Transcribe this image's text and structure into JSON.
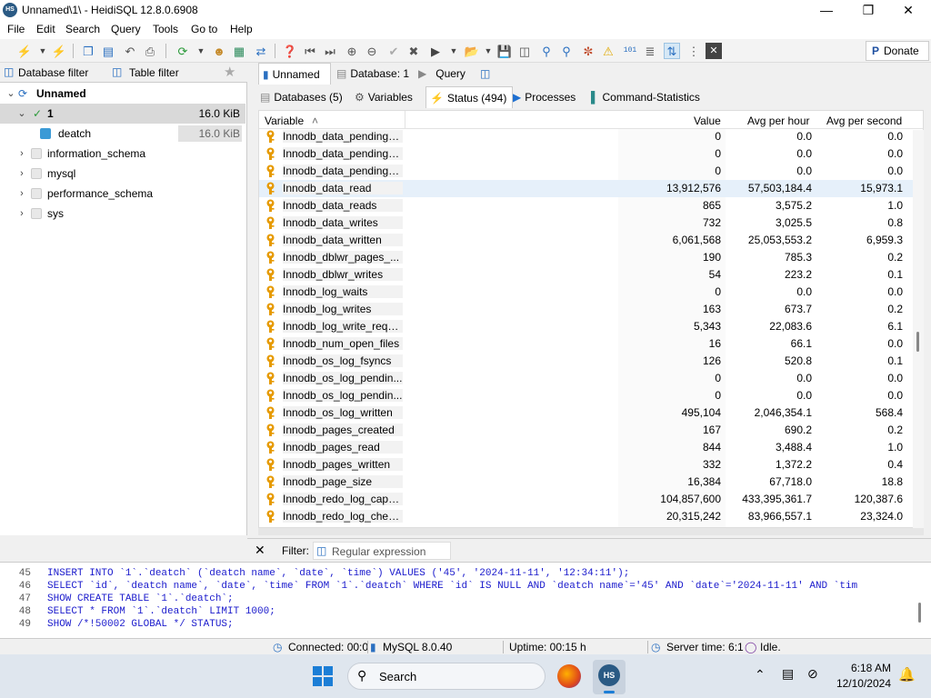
{
  "window": {
    "title": "Unnamed\\1\\ - HeidiSQL 12.8.0.6908",
    "app_badge": "HS"
  },
  "menu": [
    "File",
    "Edit",
    "Search",
    "Query",
    "Tools",
    "Go to",
    "Help"
  ],
  "toolbar": {
    "donate_label": "Donate"
  },
  "left_panel": {
    "db_filter": "Database filter",
    "table_filter": "Table filter",
    "tree": [
      {
        "label": "Unnamed",
        "size": "",
        "level": 0
      },
      {
        "label": "1",
        "size": "16.0 KiB",
        "level": 1
      },
      {
        "label": "deatch",
        "size": "16.0 KiB",
        "level": 2
      },
      {
        "label": "information_schema",
        "size": "",
        "level": 1
      },
      {
        "label": "mysql",
        "size": "",
        "level": 1
      },
      {
        "label": "performance_schema",
        "size": "",
        "level": 1
      },
      {
        "label": "sys",
        "size": "",
        "level": 1
      }
    ]
  },
  "main_tabs": [
    "Unnamed",
    "Database: 1",
    "Query"
  ],
  "sub_tabs": [
    "Databases (5)",
    "Variables",
    "Status (494)",
    "Processes",
    "Command-Statistics"
  ],
  "grid": {
    "headers": [
      "Variable",
      "Value",
      "Avg per hour",
      "Avg per second"
    ],
    "rows": [
      [
        "Innodb_data_pending_...",
        "0",
        "0.0",
        "0.0"
      ],
      [
        "Innodb_data_pending_...",
        "0",
        "0.0",
        "0.0"
      ],
      [
        "Innodb_data_pending_...",
        "0",
        "0.0",
        "0.0"
      ],
      [
        "Innodb_data_read",
        "13,912,576",
        "57,503,184.4",
        "15,973.1"
      ],
      [
        "Innodb_data_reads",
        "865",
        "3,575.2",
        "1.0"
      ],
      [
        "Innodb_data_writes",
        "732",
        "3,025.5",
        "0.8"
      ],
      [
        "Innodb_data_written",
        "6,061,568",
        "25,053,553.2",
        "6,959.3"
      ],
      [
        "Innodb_dblwr_pages_...",
        "190",
        "785.3",
        "0.2"
      ],
      [
        "Innodb_dblwr_writes",
        "54",
        "223.2",
        "0.1"
      ],
      [
        "Innodb_log_waits",
        "0",
        "0.0",
        "0.0"
      ],
      [
        "Innodb_log_writes",
        "163",
        "673.7",
        "0.2"
      ],
      [
        "Innodb_log_write_requ...",
        "5,343",
        "22,083.6",
        "6.1"
      ],
      [
        "Innodb_num_open_files",
        "16",
        "66.1",
        "0.0"
      ],
      [
        "Innodb_os_log_fsyncs",
        "126",
        "520.8",
        "0.1"
      ],
      [
        "Innodb_os_log_pendin...",
        "0",
        "0.0",
        "0.0"
      ],
      [
        "Innodb_os_log_pendin...",
        "0",
        "0.0",
        "0.0"
      ],
      [
        "Innodb_os_log_written",
        "495,104",
        "2,046,354.1",
        "568.4"
      ],
      [
        "Innodb_pages_created",
        "167",
        "690.2",
        "0.2"
      ],
      [
        "Innodb_pages_read",
        "844",
        "3,488.4",
        "1.0"
      ],
      [
        "Innodb_pages_written",
        "332",
        "1,372.2",
        "0.4"
      ],
      [
        "Innodb_page_size",
        "16,384",
        "67,718.0",
        "18.8"
      ],
      [
        "Innodb_redo_log_capa...",
        "104,857,600",
        "433,395,361.7",
        "120,387.6"
      ],
      [
        "Innodb_redo_log_chec...",
        "20,315,242",
        "83,966,557.1",
        "23,324.0"
      ]
    ]
  },
  "filter": {
    "label": "Filter:",
    "placeholder": "Regular expression"
  },
  "sql_log": [
    {
      "n": "45",
      "text": "INSERT INTO `1`.`deatch` (`deatch name`, `date`, `time`) VALUES ('45', '2024-11-11', '12:34:11');"
    },
    {
      "n": "46",
      "text": "SELECT `id`, `deatch name`, `date`, `time` FROM `1`.`deatch` WHERE  `id` IS NULL AND `deatch name`='45' AND `date`='2024-11-11' AND `tim"
    },
    {
      "n": "47",
      "text": "SHOW CREATE TABLE `1`.`deatch`;"
    },
    {
      "n": "48",
      "text": "SELECT * FROM `1`.`deatch` LIMIT 1000;"
    },
    {
      "n": "49",
      "text": "SHOW /*!50002 GLOBAL */ STATUS;"
    }
  ],
  "statusbar": {
    "connected": "Connected: 00:0",
    "server": "MySQL 8.0.40",
    "uptime": "Uptime: 00:15 h",
    "server_time": "Server time: 6:1",
    "state": "Idle."
  },
  "taskbar": {
    "search": "Search",
    "time": "6:18 AM",
    "date": "12/10/2024",
    "app_badge": "HS"
  },
  "colors": {
    "accent": "#1e6fd0",
    "key_icon": "#e69a00",
    "selected": "#d9d9d9"
  }
}
